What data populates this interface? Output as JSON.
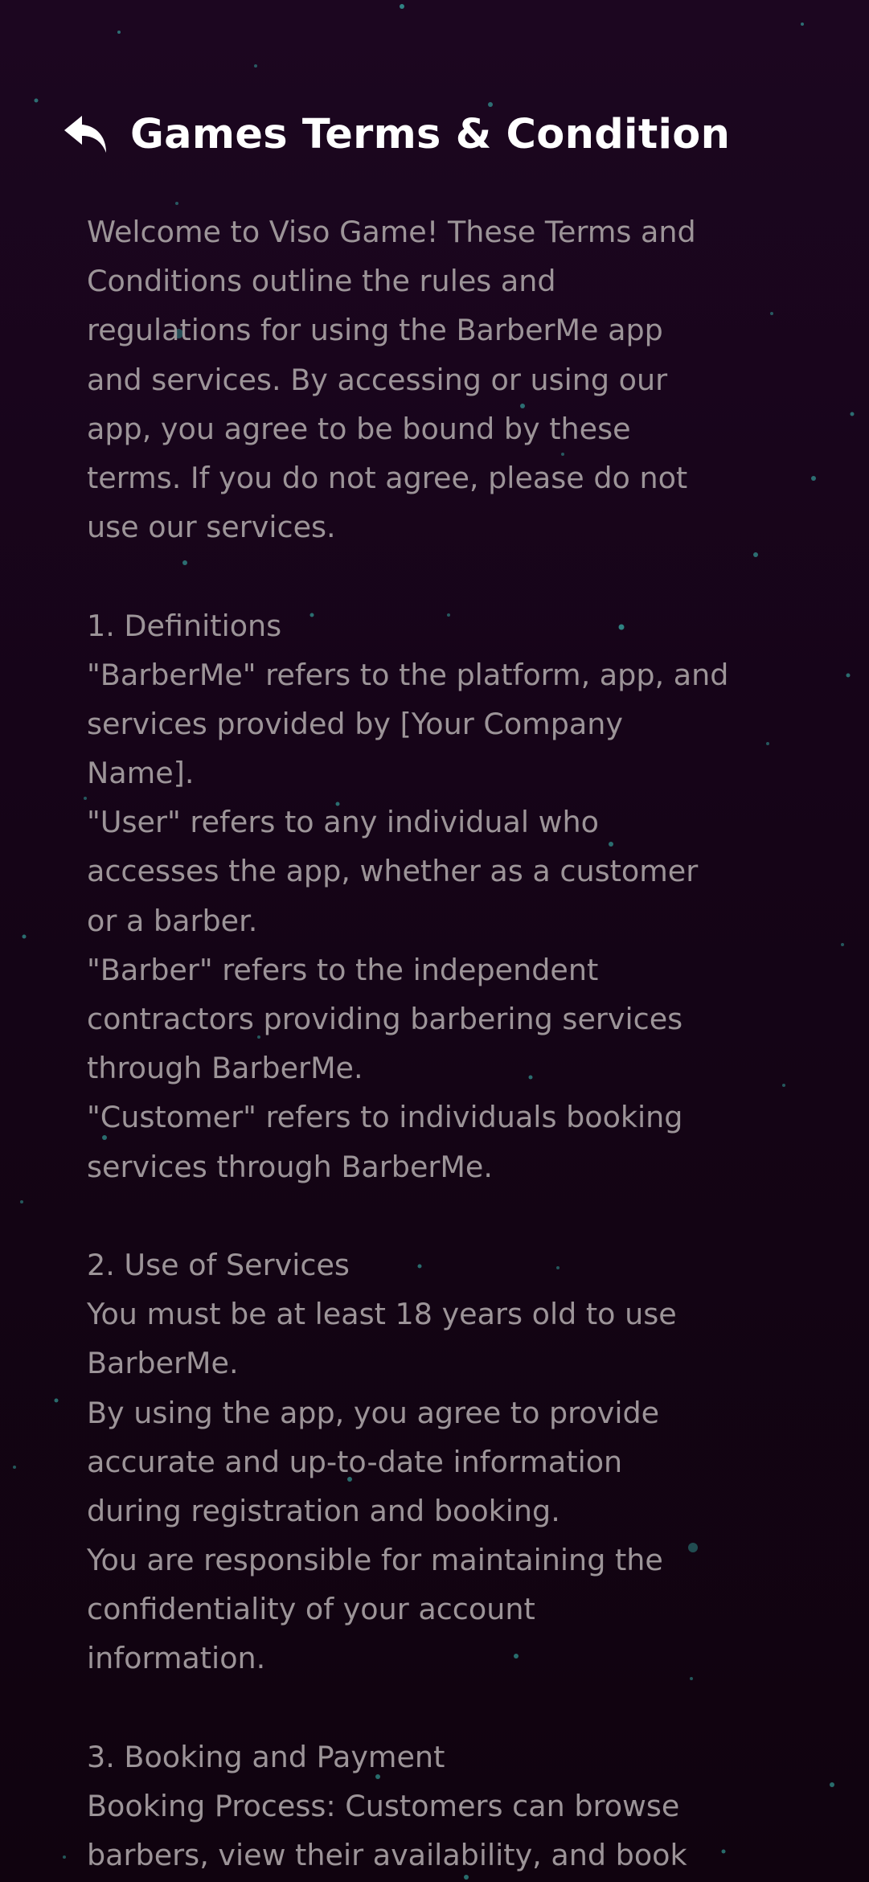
{
  "header": {
    "title": "Games Terms & Condition",
    "back_icon": "reply-arrow-icon"
  },
  "theme": {
    "background": "#150417",
    "text": "#9c9498",
    "title": "#ffffff",
    "star": "#3fd6c8"
  },
  "terms": {
    "intro": [
      "Welcome to Viso Game! These Terms and",
      "Conditions outline the rules and",
      "regulations for using the BarberMe app",
      "and services. By accessing or using our",
      "app, you agree to be bound by these",
      "terms. If you do not agree, please do not",
      "use our services."
    ],
    "section1": [
      "1. Definitions",
      "\"BarberMe\" refers to the platform, app, and",
      "services provided by [Your Company",
      "Name].",
      "\"User\" refers to any individual who",
      "accesses the app, whether as a customer",
      "or a barber.",
      "\"Barber\" refers to the independent",
      "contractors providing barbering services",
      "through BarberMe.",
      "\"Customer\" refers to individuals booking",
      "services through BarberMe."
    ],
    "section2": [
      "2. Use of Services",
      "You must be at least 18 years old to use",
      "BarberMe.",
      "By using the app, you agree to provide",
      "accurate and up-to-date information",
      "during registration and booking.",
      "You are responsible for maintaining the",
      "confidentiality of your account",
      "information."
    ],
    "section3": [
      "3. Booking and Payment",
      "Booking Process: Customers can browse",
      "barbers, view their availability, and book"
    ]
  }
}
